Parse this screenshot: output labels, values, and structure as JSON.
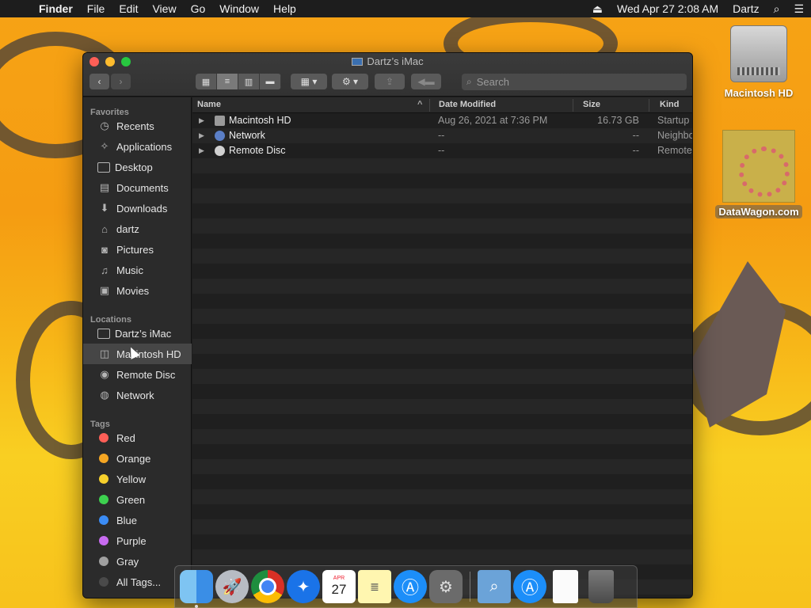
{
  "menubar": {
    "apple": "",
    "items": [
      "Finder",
      "File",
      "Edit",
      "View",
      "Go",
      "Window",
      "Help"
    ],
    "eject": "⏏",
    "datetime": "Wed Apr 27  2:08 AM",
    "user": "Dartz",
    "search_glyph": "⌕",
    "list_glyph": "☰"
  },
  "window": {
    "title": "Dartz’s iMac",
    "search_placeholder": "Search"
  },
  "sidebar": {
    "favorites_title": "Favorites",
    "favorites": [
      {
        "label": "Recents",
        "icon": "clock-icon"
      },
      {
        "label": "Applications",
        "icon": "applications-icon"
      },
      {
        "label": "Desktop",
        "icon": "desktop-icon"
      },
      {
        "label": "Documents",
        "icon": "documents-icon"
      },
      {
        "label": "Downloads",
        "icon": "downloads-icon"
      },
      {
        "label": "dartz",
        "icon": "home-icon"
      },
      {
        "label": "Pictures",
        "icon": "camera-icon"
      },
      {
        "label": "Music",
        "icon": "music-note-icon"
      },
      {
        "label": "Movies",
        "icon": "film-icon"
      }
    ],
    "locations_title": "Locations",
    "locations": [
      {
        "label": "Dartz’s iMac",
        "icon": "imac-icon"
      },
      {
        "label": "Macintosh HD",
        "icon": "hard-drive-icon",
        "selected": true
      },
      {
        "label": "Remote Disc",
        "icon": "disc-icon"
      },
      {
        "label": "Network",
        "icon": "globe-icon"
      }
    ],
    "tags_title": "Tags",
    "tags": [
      {
        "label": "Red",
        "color": "#fe5f57"
      },
      {
        "label": "Orange",
        "color": "#f5a623"
      },
      {
        "label": "Yellow",
        "color": "#f7d02c"
      },
      {
        "label": "Green",
        "color": "#3dd14f"
      },
      {
        "label": "Blue",
        "color": "#3b8cf5"
      },
      {
        "label": "Purple",
        "color": "#c86bf0"
      },
      {
        "label": "Gray",
        "color": "#a0a0a0"
      },
      {
        "label": "All Tags...",
        "color": "#4a4a4a"
      }
    ]
  },
  "columns": {
    "name": "Name",
    "date": "Date Modified",
    "size": "Size",
    "kind": "Kind"
  },
  "rows": [
    {
      "name": "Macintosh HD",
      "date": "Aug 26, 2021 at 7:36 PM",
      "size": "16.73 GB",
      "kind": "Startup",
      "icon": "hard-drive-icon"
    },
    {
      "name": "Network",
      "date": "--",
      "size": "--",
      "kind": "Neighbo",
      "icon": "globe-icon"
    },
    {
      "name": "Remote Disc",
      "date": "--",
      "size": "--",
      "kind": "Remote",
      "icon": "disc-icon"
    }
  ],
  "desktop": {
    "hd_label": "Macintosh HD",
    "image_label": "DataWagon.com"
  },
  "dock": {
    "calendar_month": "APR",
    "calendar_day": "27"
  }
}
